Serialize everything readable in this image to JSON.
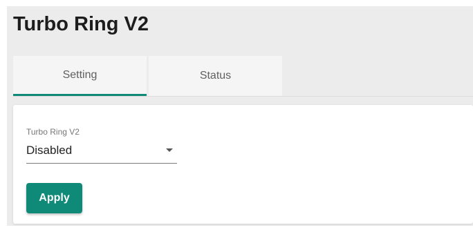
{
  "page": {
    "title": "Turbo Ring V2"
  },
  "tabs": [
    {
      "label": "Setting",
      "active": true
    },
    {
      "label": "Status",
      "active": false
    }
  ],
  "form": {
    "field_label": "Turbo Ring V2",
    "selected_value": "Disabled",
    "apply_label": "Apply"
  },
  "colors": {
    "accent": "#0f8a78",
    "background": "#ececec",
    "card": "#ffffff"
  },
  "icons": {
    "select_caret": "caret-down-icon"
  }
}
